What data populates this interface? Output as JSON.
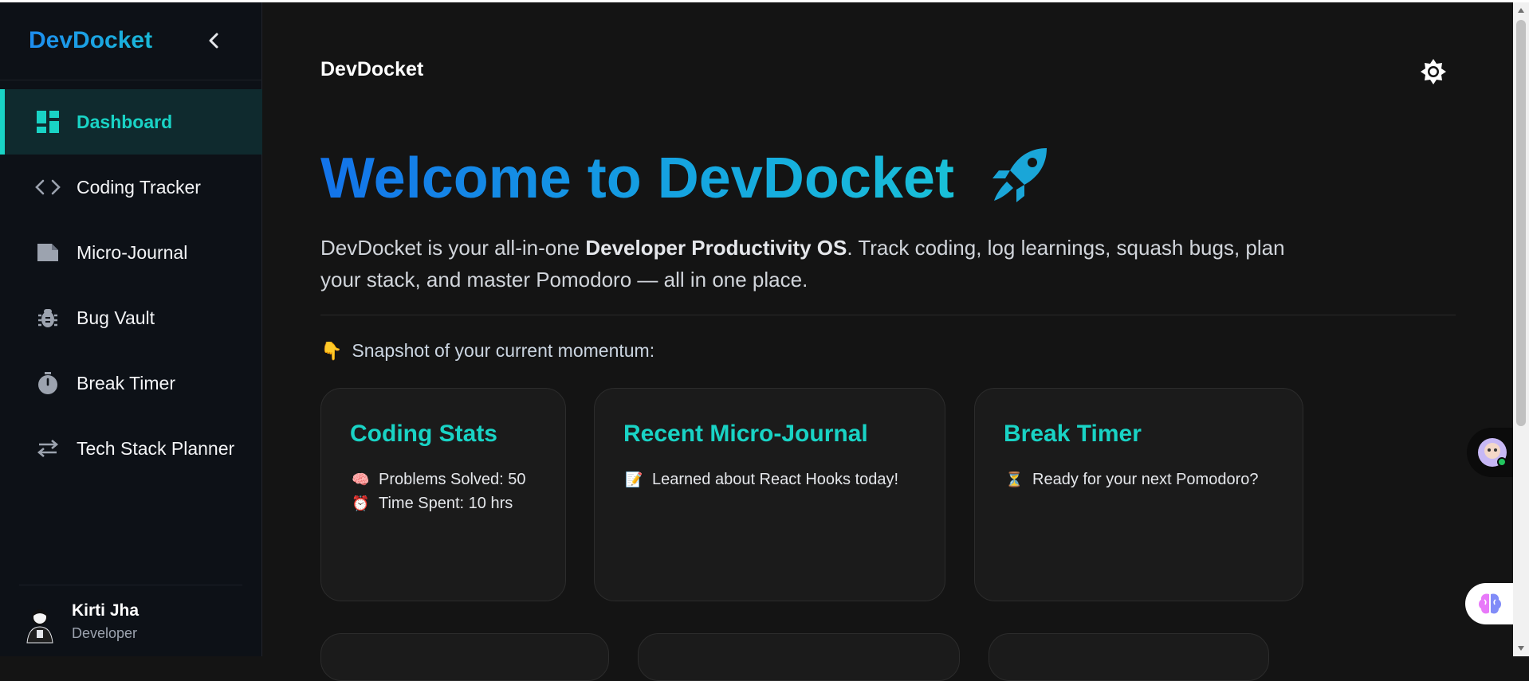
{
  "sidebar": {
    "brand": "DevDocket",
    "items": [
      {
        "label": "Dashboard",
        "icon": "dashboard-icon",
        "active": true
      },
      {
        "label": "Coding Tracker",
        "icon": "code-icon"
      },
      {
        "label": "Micro-Journal",
        "icon": "file-icon"
      },
      {
        "label": "Bug Vault",
        "icon": "bug-icon"
      },
      {
        "label": "Break Timer",
        "icon": "stopwatch-icon"
      },
      {
        "label": "Tech Stack Planner",
        "icon": "arrows-swap-icon"
      }
    ],
    "user": {
      "name": "Kirti Jha",
      "role": "Developer"
    }
  },
  "header": {
    "title": "DevDocket",
    "theme_icon": "sun-icon"
  },
  "hero": {
    "title": "Welcome to DevDocket",
    "emoji_icon": "rocket-icon"
  },
  "intro": {
    "before": "DevDocket is your all-in-one ",
    "bold": "Developer Productivity OS",
    "after": ". Track coding, log learnings, squash bugs, plan your stack, and master Pomodoro — all in one place."
  },
  "snapshot": {
    "emoji": "👇",
    "text": "Snapshot of your current momentum:"
  },
  "cards": [
    {
      "title": "Coding Stats",
      "lines": [
        {
          "emoji": "🧠",
          "text": "Problems Solved: 50"
        },
        {
          "emoji": "⏰",
          "text": "Time Spent: 10 hrs"
        }
      ]
    },
    {
      "title": "Recent Micro-Journal",
      "lines": [
        {
          "emoji": "📝",
          "text": "Learned about React Hooks today!"
        }
      ]
    },
    {
      "title": "Break Timer",
      "lines": [
        {
          "emoji": "⏳",
          "text": "Ready for your next Pomodoro?"
        }
      ]
    }
  ],
  "colors": {
    "accent": "#19d3c5",
    "brand_blue": "#1d8df0",
    "sidebar_bg": "#0d1117",
    "main_bg": "#141414",
    "card_bg": "#1b1b1b"
  }
}
